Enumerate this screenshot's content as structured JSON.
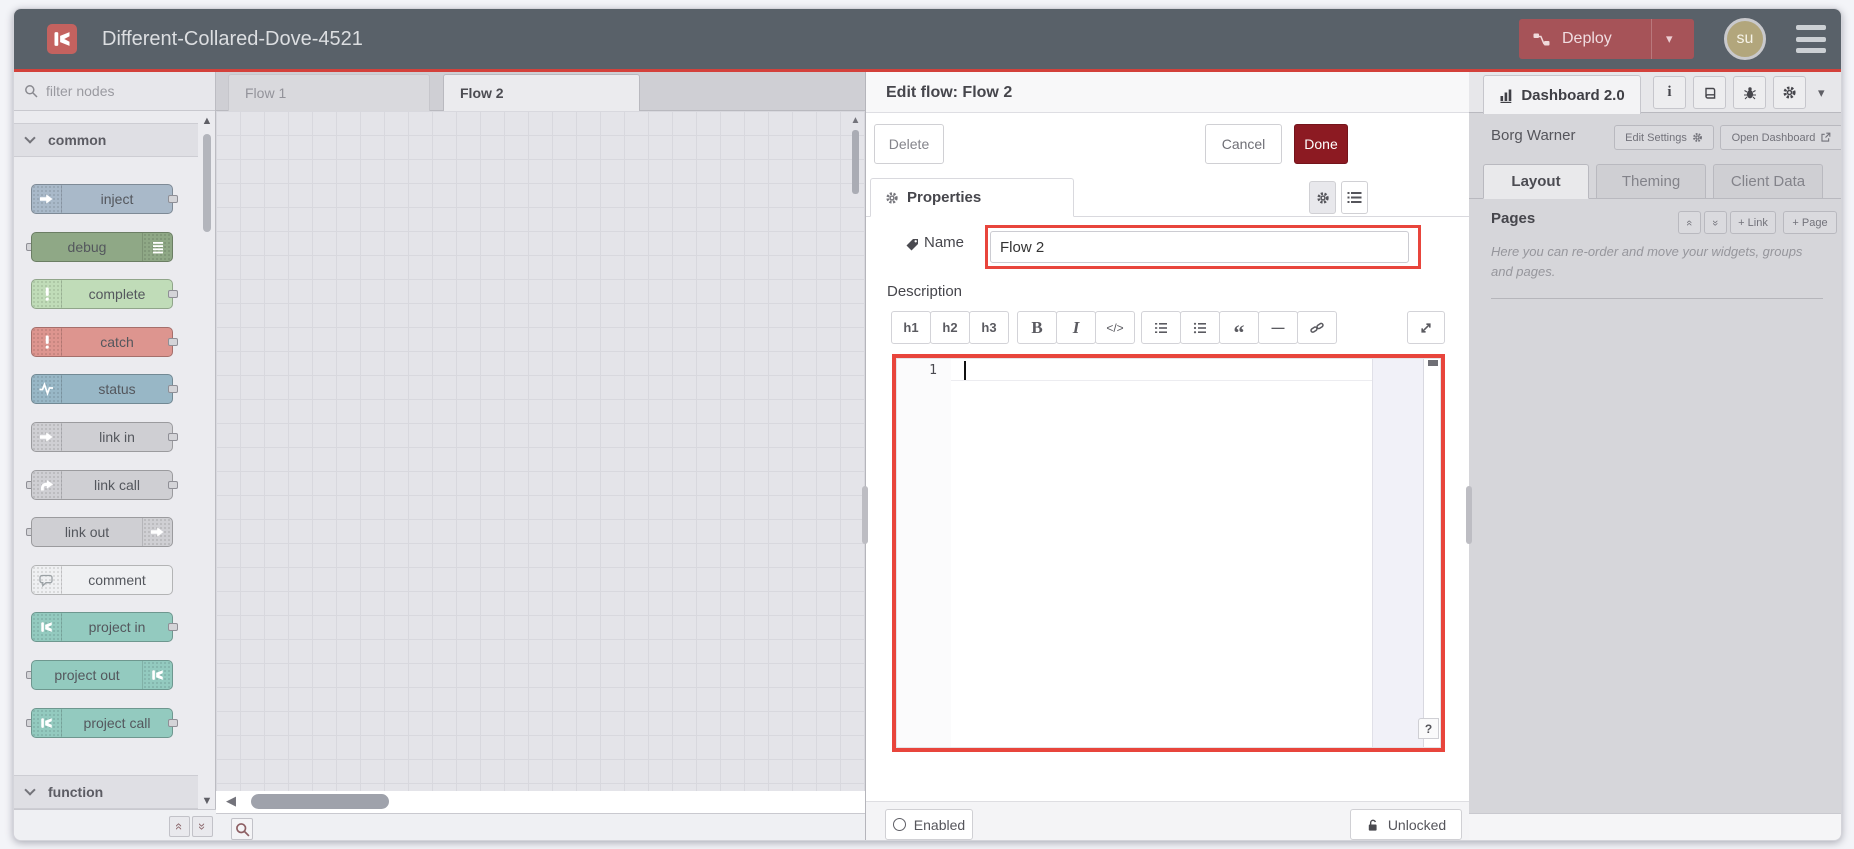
{
  "header": {
    "title": "Different-Collared-Dove-4521",
    "deploy_label": "Deploy",
    "avatar_text": "su",
    "caret_glyph": "▾"
  },
  "palette": {
    "filter_placeholder": "filter nodes",
    "categories": [
      {
        "label": "common"
      },
      {
        "label": "function"
      }
    ],
    "nodes": [
      {
        "label": "inject",
        "color": "#a9b9c9",
        "icon": "arrow-right-icon",
        "icon_side": "left",
        "ports": "right"
      },
      {
        "label": "debug",
        "color": "#8fa886",
        "icon": "debug-list-icon",
        "icon_side": "right",
        "ports": "left"
      },
      {
        "label": "complete",
        "color": "#c0dcb8",
        "icon": "exclamation-icon",
        "icon_side": "left",
        "ports": "right"
      },
      {
        "label": "catch",
        "color": "#dd958f",
        "icon": "exclamation-icon",
        "icon_side": "left",
        "ports": "right"
      },
      {
        "label": "status",
        "color": "#98b7c6",
        "icon": "status-pulse-icon",
        "icon_side": "left",
        "ports": "right"
      },
      {
        "label": "link in",
        "color": "#cfcfd3",
        "icon": "arrow-right-icon",
        "icon_side": "left",
        "ports": "right"
      },
      {
        "label": "link call",
        "color": "#cfcfd3",
        "icon": "link-call-icon",
        "icon_side": "left",
        "ports": "both"
      },
      {
        "label": "link out",
        "color": "#cfcfd3",
        "icon": "arrow-right-icon",
        "icon_side": "right",
        "ports": "left"
      },
      {
        "label": "comment",
        "color": "#eff0f2",
        "icon": "comment-bubble-icon",
        "icon_side": "left",
        "ports": "none"
      },
      {
        "label": "project in",
        "color": "#93cabf",
        "icon": "project-icon",
        "icon_side": "left",
        "ports": "right"
      },
      {
        "label": "project out",
        "color": "#93cabf",
        "icon": "project-icon",
        "icon_side": "right",
        "ports": "left"
      },
      {
        "label": "project call",
        "color": "#93cabf",
        "icon": "project-icon",
        "icon_side": "left",
        "ports": "both"
      }
    ],
    "scroll_up_glyph": "▲",
    "scroll_down_glyph": "▼",
    "collapse_all_glyph": "«",
    "expand_all_glyph": "»"
  },
  "workspace": {
    "tabs": [
      {
        "label": "Flow 1",
        "active": false
      },
      {
        "label": "Flow 2",
        "active": true
      }
    ],
    "scroll_left_glyph": "◀",
    "scroll_up_glyph": "▲"
  },
  "tray": {
    "title": "Edit flow: Flow 2",
    "delete_label": "Delete",
    "cancel_label": "Cancel",
    "done_label": "Done",
    "properties_tab": "Properties",
    "name_label": "Name",
    "name_value": "Flow 2",
    "description_label": "Description",
    "toolbar": {
      "group_heading": [
        {
          "name": "heading-1",
          "glyph": "h1"
        },
        {
          "name": "heading-2",
          "glyph": "h2"
        },
        {
          "name": "heading-3",
          "glyph": "h3"
        }
      ],
      "group_format": [
        {
          "name": "bold",
          "glyph": "B"
        },
        {
          "name": "italic",
          "glyph": "I"
        },
        {
          "name": "code",
          "glyph": "</>"
        }
      ],
      "group_block": [
        {
          "name": "ordered-list",
          "icon": "ordered-list-icon"
        },
        {
          "name": "unordered-list",
          "icon": "unordered-list-icon"
        },
        {
          "name": "quote",
          "glyph": "“"
        },
        {
          "name": "horizontal-rule",
          "glyph": "—"
        },
        {
          "name": "link",
          "icon": "link-icon"
        }
      ]
    },
    "editor": {
      "line_number": "1",
      "help_label": "?"
    },
    "enabled_label": "Enabled",
    "unlocked_label": "Unlocked"
  },
  "sidebar": {
    "dashboard_tab": "Dashboard 2.0",
    "caret_glyph": "▾",
    "project_name": "Borg Warner",
    "edit_settings_label": "Edit Settings",
    "open_dashboard_label": "Open Dashboard",
    "tabs": [
      {
        "label": "Layout",
        "active": true
      },
      {
        "label": "Theming",
        "active": false
      },
      {
        "label": "Client Data",
        "active": false
      }
    ],
    "pages_title": "Pages",
    "pages_up_glyph": "«",
    "pages_down_glyph": "»",
    "add_link_label": "+ Link",
    "add_page_label": "+ Page",
    "help_text": "Here you can re-order and move your widgets, groups and pages."
  },
  "colors": {
    "header_bg": "#596169",
    "accent_red_line": "#d3413b",
    "deploy_bg": "#a65358",
    "done_bg": "#8c1a22",
    "highlight_red": "#e8453c",
    "avatar_bg": "#b2a67c"
  }
}
